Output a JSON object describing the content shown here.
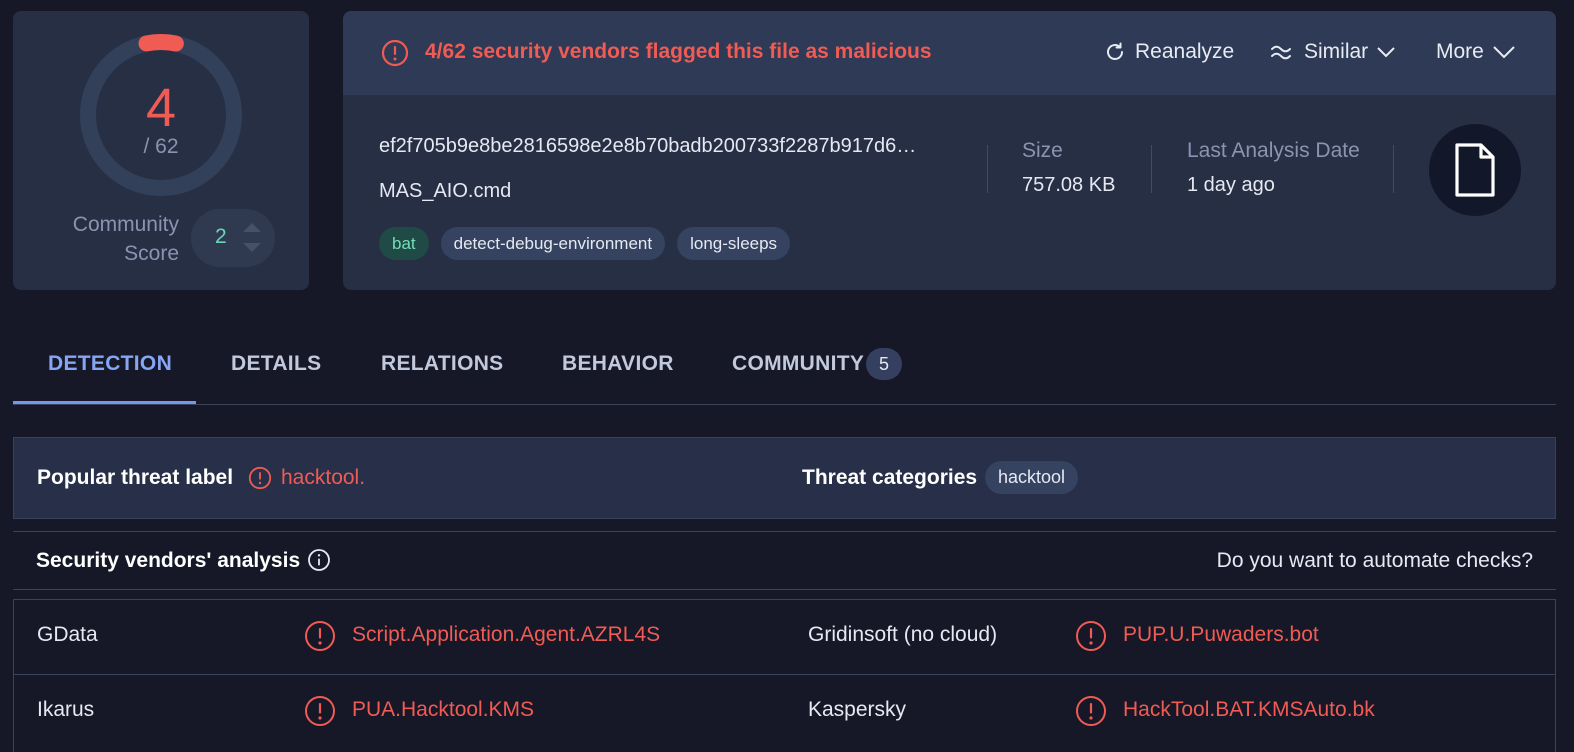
{
  "colors": {
    "background": "#161827",
    "card": "#272f45",
    "malicious": "#f05b54",
    "accent": "#86a6f5",
    "tag_green": "#76dcba"
  },
  "score": {
    "detections": "4",
    "total": "/ 62",
    "fraction_flagged": 0.0645,
    "community_label_line1": "Community",
    "community_label_line2": "Score",
    "community_value": "2",
    "vote_up_icon": "chevron-up-icon",
    "vote_down_icon": "chevron-down-icon"
  },
  "header": {
    "alert_icon": "alert-circle-icon",
    "alert_text": "4/62 security vendors flagged this file as malicious",
    "reanalyze_label": "Reanalyze",
    "similar_label": "Similar",
    "more_label": "More"
  },
  "file": {
    "hash": "ef2f705b9e8be2816598e2e8b70badb200733f2287b917d6…",
    "name": "MAS_AIO.cmd",
    "tags": [
      "bat",
      "detect-debug-environment",
      "long-sleeps"
    ],
    "size_label": "Size",
    "size_value": "757.08 KB",
    "date_label": "Last Analysis Date",
    "date_value": "1 day ago",
    "type_icon": "file-icon"
  },
  "tabs": [
    {
      "label": "DETECTION",
      "active": true
    },
    {
      "label": "DETAILS",
      "active": false
    },
    {
      "label": "RELATIONS",
      "active": false
    },
    {
      "label": "BEHAVIOR",
      "active": false
    },
    {
      "label": "COMMUNITY",
      "active": false,
      "count": "5"
    }
  ],
  "threat": {
    "popular_label": "Popular threat label",
    "popular_value": "hacktool.",
    "categories_label": "Threat categories",
    "categories": [
      "hacktool"
    ]
  },
  "vendors": {
    "title": "Security vendors' analysis",
    "automate_link": "Do you want to automate checks?",
    "rows": [
      [
        {
          "vendor": "GData",
          "result": "Script.Application.Agent.AZRL4S"
        },
        {
          "vendor": "Gridinsoft (no cloud)",
          "result": "PUP.U.Puwaders.bot"
        }
      ],
      [
        {
          "vendor": "Ikarus",
          "result": "PUA.Hacktool.KMS"
        },
        {
          "vendor": "Kaspersky",
          "result": "HackTool.BAT.KMSAuto.bk"
        }
      ]
    ]
  }
}
